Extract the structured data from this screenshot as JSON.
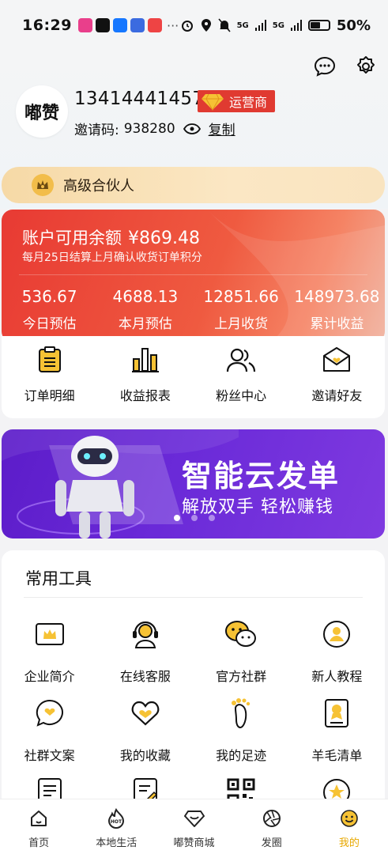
{
  "status_bar": {
    "time": "16:29",
    "more": "···",
    "network_1": "5G",
    "network_2": "5G",
    "battery": "50%"
  },
  "profile": {
    "logo_text": "嘟赞",
    "phone": "13414441457",
    "role_badge": "运营商",
    "invite_label": "邀请码:",
    "invite_code": "938280",
    "copy_label": "复制"
  },
  "partner_bar": {
    "label": "高级合伙人"
  },
  "balance_card": {
    "title": "账户可用余额",
    "amount": "¥869.48",
    "note": "每月25日结算上月确认收货订单积分",
    "stats": [
      {
        "value": "536.67",
        "label": "今日预估"
      },
      {
        "value": "4688.13",
        "label": "本月预估"
      },
      {
        "value": "12851.66",
        "label": "上月收货"
      },
      {
        "value": "148973.68",
        "label": "累计收益"
      }
    ]
  },
  "quick_actions": [
    {
      "label": "订单明细",
      "icon": "clipboard-icon"
    },
    {
      "label": "收益报表",
      "icon": "bar-chart-icon"
    },
    {
      "label": "粉丝中心",
      "icon": "people-icon"
    },
    {
      "label": "邀请好友",
      "icon": "envelope-heart-icon"
    }
  ],
  "banner": {
    "title": "智能云发单",
    "subtitle": "解放双手 轻松赚钱",
    "slides": 3,
    "active_slide": 1
  },
  "tools": {
    "title": "常用工具",
    "items": [
      {
        "label": "企业简介",
        "icon": "crown-card-icon"
      },
      {
        "label": "在线客服",
        "icon": "headset-icon"
      },
      {
        "label": "官方社群",
        "icon": "wechat-icon"
      },
      {
        "label": "新人教程",
        "icon": "person-circle-icon"
      },
      {
        "label": "社群文案",
        "icon": "heart-bubble-icon"
      },
      {
        "label": "我的收藏",
        "icon": "heart-icon"
      },
      {
        "label": "我的足迹",
        "icon": "footprint-icon"
      },
      {
        "label": "羊毛清单",
        "icon": "list-badge-icon"
      },
      {
        "label": "",
        "icon": "document-icon"
      },
      {
        "label": "",
        "icon": "edit-doc-icon"
      },
      {
        "label": "",
        "icon": "qrcode-icon"
      },
      {
        "label": "",
        "icon": "star-circle-icon"
      }
    ]
  },
  "bottom_nav": [
    {
      "label": "首页",
      "icon": "home-icon"
    },
    {
      "label": "本地生活",
      "icon": "hot-icon"
    },
    {
      "label": "嘟赞商城",
      "icon": "diamond-icon"
    },
    {
      "label": "发圈",
      "icon": "aperture-icon"
    },
    {
      "label": "我的",
      "icon": "smile-icon",
      "active": true
    }
  ],
  "colors": {
    "accent": "#e8a800",
    "card_red": "#e83a33",
    "banner_purple": "#5c1cc9"
  }
}
